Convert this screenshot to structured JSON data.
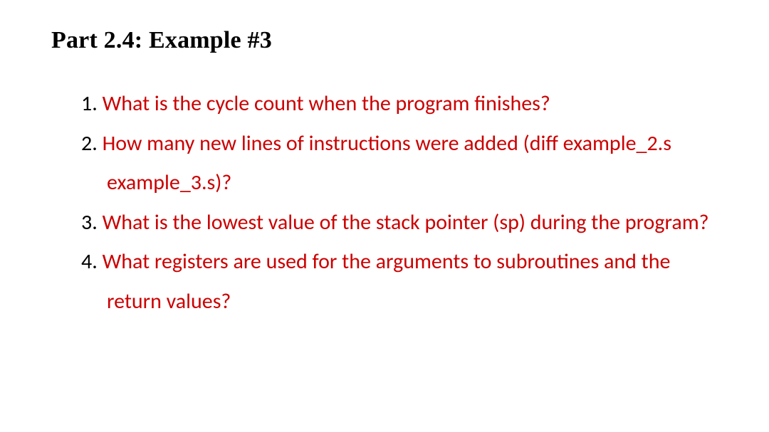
{
  "heading": "Part 2.4: Example #3",
  "questions": [
    {
      "marker": "1. ",
      "text": "What is the cycle count when the program finishes?"
    },
    {
      "marker": "2. ",
      "text": "How many new lines of instructions were added (diff example_2.s example_3.s)?"
    },
    {
      "marker": "3. ",
      "text": "What is the lowest value of the stack pointer (sp) during the program?"
    },
    {
      "marker": "4. ",
      "text": "What registers are used for the arguments to subroutines and the return values?"
    }
  ]
}
